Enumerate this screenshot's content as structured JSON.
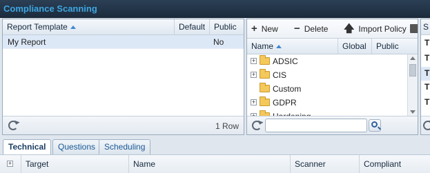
{
  "title": "Compliance Scanning",
  "templates": {
    "columns": [
      "Report Template",
      "Default",
      "Public"
    ],
    "rows": [
      {
        "name": "My Report",
        "default": "",
        "public": "No"
      }
    ],
    "row_count": "1 Row"
  },
  "policies": {
    "toolbar": {
      "new_label": "New",
      "delete_label": "Delete",
      "import_label": "Import Policy"
    },
    "columns": [
      "Name",
      "Global",
      "Public"
    ],
    "folders": [
      {
        "name": "ADSIC",
        "expandable": true
      },
      {
        "name": "CIS",
        "expandable": true
      },
      {
        "name": "Custom",
        "expandable": false
      },
      {
        "name": "GDPR",
        "expandable": true
      },
      {
        "name": "Hardening",
        "expandable": true
      }
    ],
    "search_value": ""
  },
  "third_panel": {
    "header": "S",
    "rows": [
      "T",
      "T",
      "T",
      "T",
      "T"
    ]
  },
  "tabs": [
    "Technical",
    "Questions",
    "Scheduling"
  ],
  "active_tab": "Technical",
  "bottom_grid": {
    "columns": [
      "Target",
      "Name",
      "Scanner",
      "Compliant"
    ]
  }
}
